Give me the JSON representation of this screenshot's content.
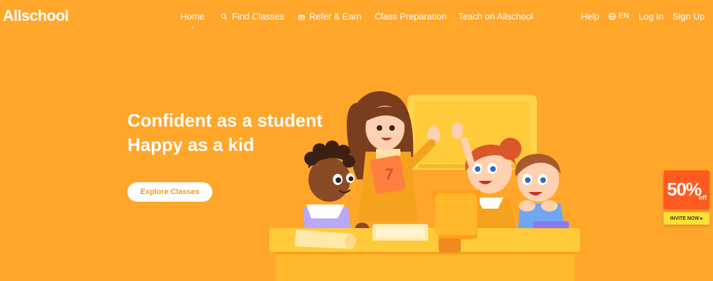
{
  "header": {
    "logo": "Allschool",
    "nav": {
      "home": "Home",
      "find_classes": "Find Classes",
      "refer_earn": "Refer & Earn",
      "class_preparation": "Class Preparation",
      "teach": "Teach on Allschool"
    },
    "right": {
      "help": "Help",
      "language": "EN",
      "login": "Log In",
      "signup": "Sign Up"
    }
  },
  "hero": {
    "title_line1": "Confident as a student",
    "title_line2": "Happy as a kid",
    "cta": "Explore Classes"
  },
  "promo": {
    "percent": "50%",
    "off": "off",
    "button": "INVITE NOW ▸"
  },
  "colors": {
    "background": "#FFA62B",
    "cta_text": "#F29A1F",
    "promo_red": "#FF5A1F",
    "promo_yellow": "#FFE033"
  },
  "icons": [
    "search-icon",
    "gift-icon",
    "globe-icon"
  ]
}
